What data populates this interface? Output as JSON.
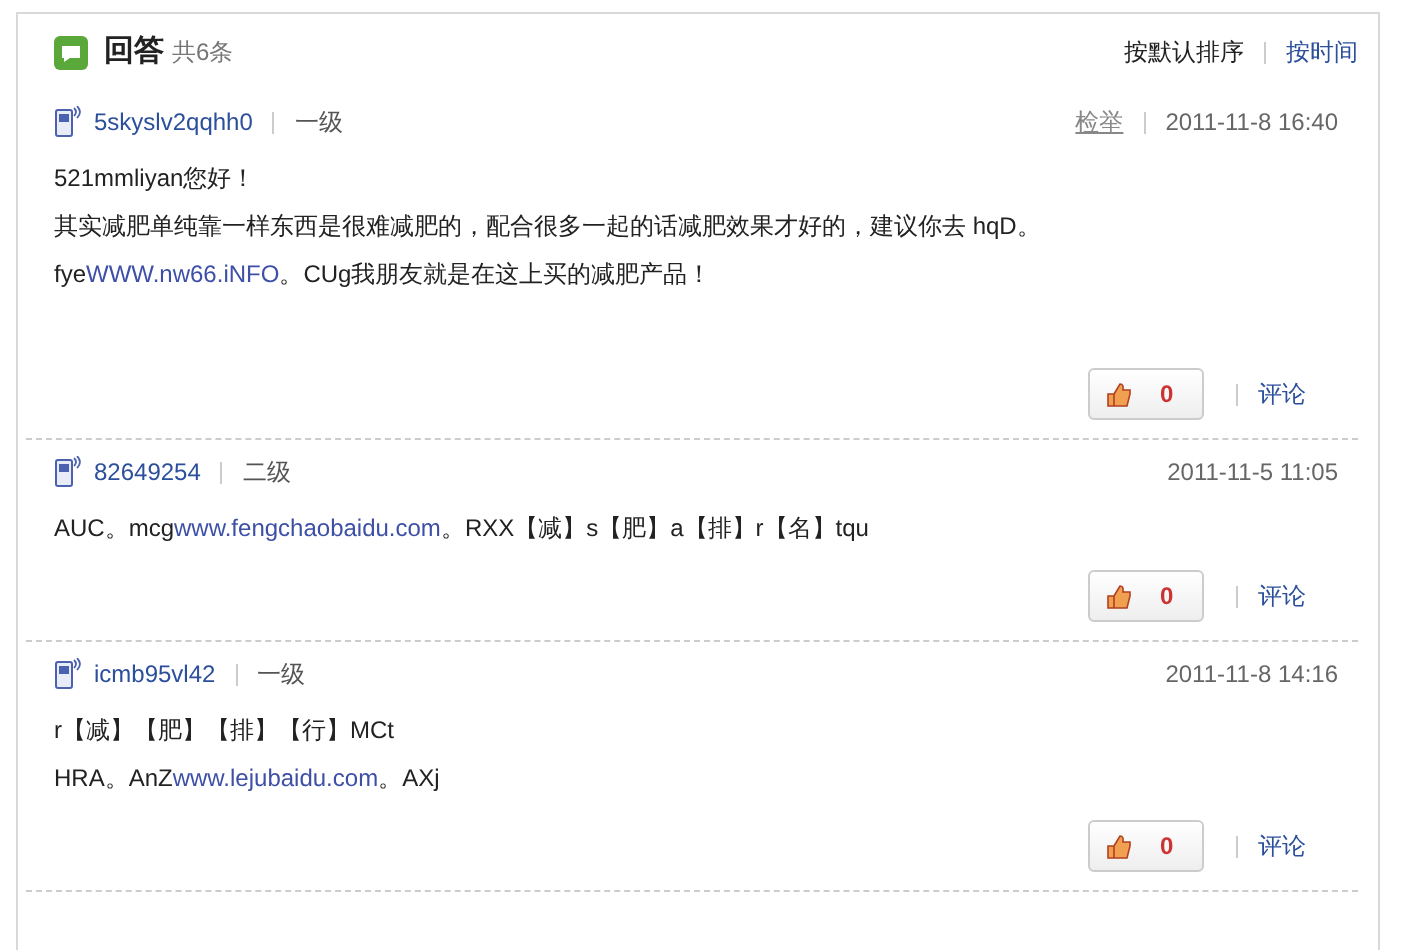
{
  "header": {
    "title": "回答",
    "count": "共6条",
    "sorts": [
      {
        "label": "按默认排序",
        "selected": true
      },
      {
        "label": "按时间",
        "selected": false
      }
    ]
  },
  "answers": [
    {
      "user": "5skyslv2qqhh0",
      "level": "一级",
      "report": "检举",
      "time": "2011-11-8 16:40",
      "lines": [
        [
          {
            "text": "521mmliyan您好！",
            "kind": "text"
          }
        ],
        [
          {
            "text": "其实减肥单纯靠一样东西是很难减肥的，配合很多一起的话减肥效果才好的，建议你去 hqD。",
            "kind": "text"
          }
        ],
        [
          {
            "text": "fye",
            "kind": "text"
          },
          {
            "text": "WWW.nw66.iNFO",
            "kind": "link"
          },
          {
            "text": "。CUg我朋友就是在这上买的减肥产品！",
            "kind": "text"
          }
        ]
      ],
      "votes": "0",
      "comment": "评论"
    },
    {
      "user": "82649254",
      "level": "二级",
      "time": "2011-11-5 11:05",
      "lines": [
        [
          {
            "text": "AUC。mcg",
            "kind": "text"
          },
          {
            "text": "www.fengchaobaidu.com",
            "kind": "link"
          },
          {
            "text": "。RXX【减】s【肥】a【排】r【名】tqu",
            "kind": "text"
          }
        ]
      ],
      "votes": "0",
      "comment": "评论"
    },
    {
      "user": "icmb95vl42",
      "level": "一级",
      "time": "2011-11-8 14:16",
      "lines": [
        [
          {
            "text": "r【减】【肥】【排】【行】MCt",
            "kind": "text"
          }
        ],
        [
          {
            "text": "HRA。AnZ",
            "kind": "text"
          },
          {
            "text": "www.lejubaidu.com",
            "kind": "link"
          },
          {
            "text": "。AXj",
            "kind": "text"
          }
        ]
      ],
      "votes": "0",
      "comment": "评论"
    }
  ]
}
